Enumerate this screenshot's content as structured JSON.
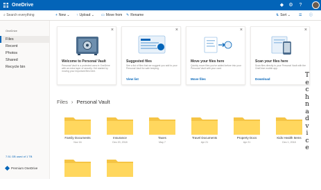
{
  "app": {
    "brand": "OneDrive"
  },
  "colors": {
    "accent": "#0364b8",
    "folder": "#ffd75e",
    "folder_back": "#f5c444"
  },
  "commandbar": {
    "search_placeholder": "Search everything",
    "new_label": "New",
    "upload_label": "Upload",
    "move_from_label": "Move from",
    "rename_label": "Rename",
    "sort_label": "Sort"
  },
  "sidebar": {
    "owner": "OneDrive",
    "items": [
      {
        "label": "Files",
        "selected": true
      },
      {
        "label": "Recent",
        "selected": false
      },
      {
        "label": "Photos",
        "selected": false
      },
      {
        "label": "Shared",
        "selected": false
      },
      {
        "label": "Recycle bin",
        "selected": false
      }
    ],
    "storage": "7.51 GB used of 1 TB",
    "premium": "Premium OneDrive"
  },
  "cards": [
    {
      "title": "Welcome to Personal Vault",
      "desc": "Personal Vault is a protected area in OneDrive with an extra layer of security. Get started by moving your important files here.",
      "link": ""
    },
    {
      "title": "Suggested files",
      "desc": "See a list of files that we suggest you add to your Personal Vault for safe keeping.",
      "link": "View list"
    },
    {
      "title": "Move your files here",
      "desc": "Quickly move files you've added before into your Personal Vault with your card.",
      "link": "Move files"
    },
    {
      "title": "Scan your files here",
      "desc": "Scan files directly to your Personal Vault with the OneDrive mobile app.",
      "link": "Download"
    }
  ],
  "breadcrumb": {
    "root": "Files",
    "current": "Personal Vault"
  },
  "folders": [
    {
      "name": "Family Documents",
      "date": "Nov 16"
    },
    {
      "name": "Insurance",
      "date": "Dec 20, 2018"
    },
    {
      "name": "Taxes",
      "date": "May 7"
    },
    {
      "name": "Travel Documents",
      "date": "Apr 21"
    },
    {
      "name": "Property Docs",
      "date": "Apr 21"
    },
    {
      "name": "Kids Health Items",
      "date": "Dec 1, 2018"
    },
    {
      "name": "",
      "date": ""
    },
    {
      "name": "",
      "date": ""
    }
  ],
  "watermark": "Technadvice"
}
